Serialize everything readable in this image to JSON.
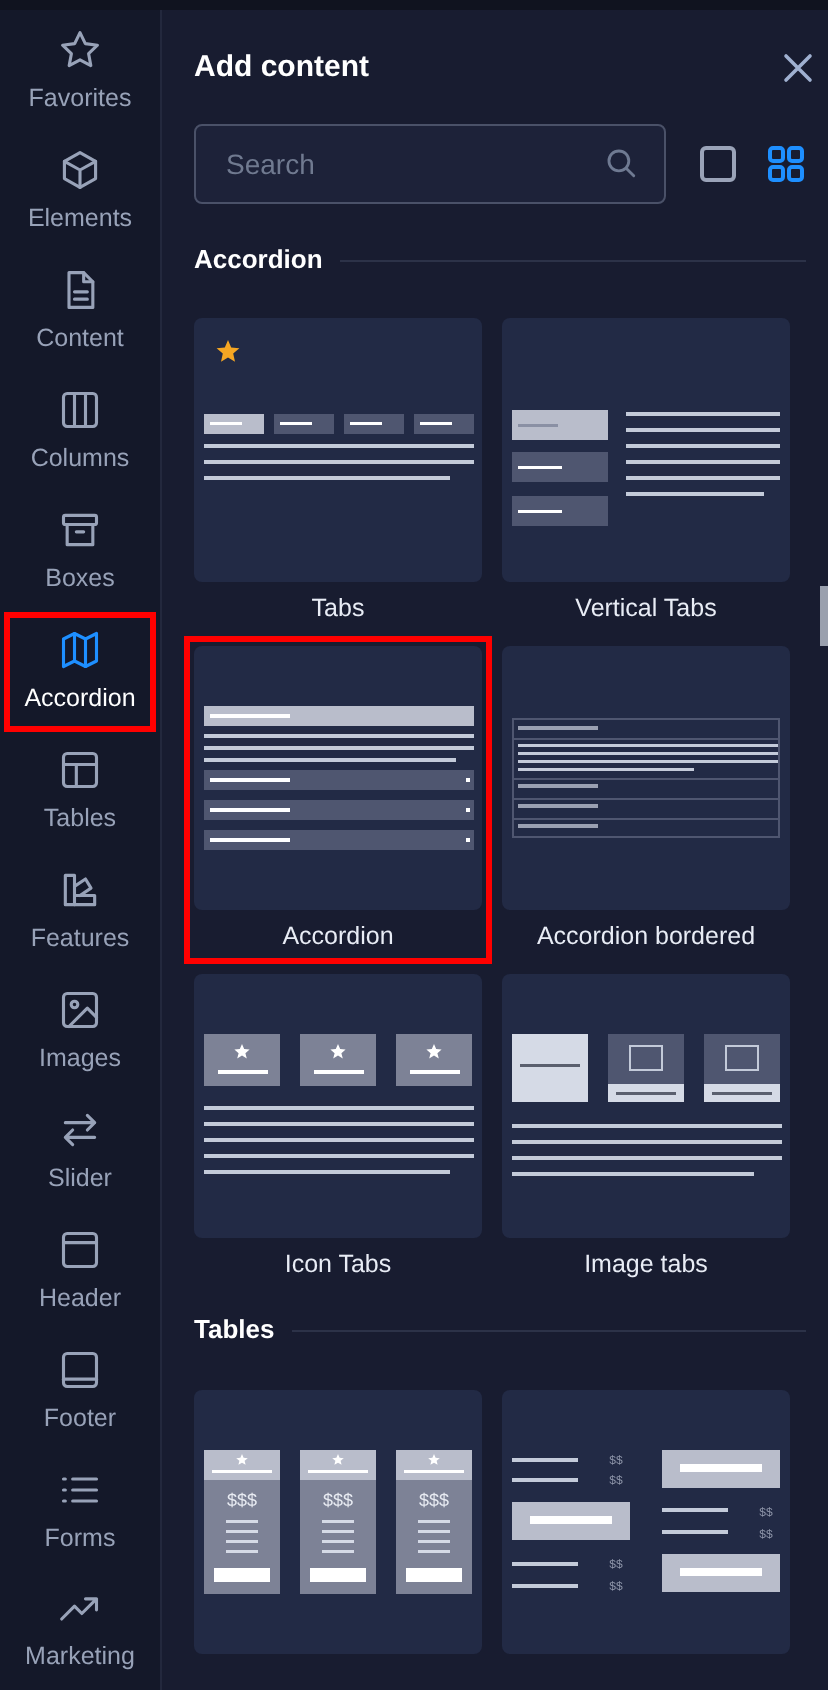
{
  "sidebar": {
    "items": [
      {
        "label": "Favorites",
        "selected": false,
        "highlighted": false
      },
      {
        "label": "Elements",
        "selected": false,
        "highlighted": false
      },
      {
        "label": "Content",
        "selected": false,
        "highlighted": false
      },
      {
        "label": "Columns",
        "selected": false,
        "highlighted": false
      },
      {
        "label": "Boxes",
        "selected": false,
        "highlighted": false
      },
      {
        "label": "Accordion",
        "selected": true,
        "highlighted": true
      },
      {
        "label": "Tables",
        "selected": false,
        "highlighted": false
      },
      {
        "label": "Features",
        "selected": false,
        "highlighted": false
      },
      {
        "label": "Images",
        "selected": false,
        "highlighted": false
      },
      {
        "label": "Slider",
        "selected": false,
        "highlighted": false
      },
      {
        "label": "Header",
        "selected": false,
        "highlighted": false
      },
      {
        "label": "Footer",
        "selected": false,
        "highlighted": false
      },
      {
        "label": "Forms",
        "selected": false,
        "highlighted": false
      },
      {
        "label": "Marketing",
        "selected": false,
        "highlighted": false
      }
    ]
  },
  "panel": {
    "title": "Add content",
    "search": {
      "placeholder": "Search"
    },
    "view_modes": [
      {
        "kind": "single",
        "selected": false
      },
      {
        "kind": "grid",
        "selected": true
      }
    ],
    "sections": [
      {
        "title": "Accordion",
        "cards": [
          {
            "label": "Tabs",
            "kind": "tabs",
            "favorite": true,
            "highlighted": false
          },
          {
            "label": "Vertical Tabs",
            "kind": "vertical_tabs",
            "favorite": false,
            "highlighted": false
          },
          {
            "label": "Accordion",
            "kind": "accordion",
            "favorite": false,
            "highlighted": true
          },
          {
            "label": "Accordion bordered",
            "kind": "accordion_bordered",
            "favorite": false,
            "highlighted": false
          },
          {
            "label": "Icon Tabs",
            "kind": "icon_tabs",
            "favorite": false,
            "highlighted": false
          },
          {
            "label": "Image tabs",
            "kind": "image_tabs",
            "favorite": false,
            "highlighted": false
          }
        ]
      },
      {
        "title": "Tables",
        "cards": [
          {
            "kind": "plans",
            "favorite": false,
            "highlighted": false,
            "price_labels": [
              "$$$",
              "$$$",
              "$$$"
            ]
          },
          {
            "kind": "price_list",
            "favorite": false,
            "highlighted": false,
            "price_labels": [
              "$$",
              "$$",
              "$$",
              "$$",
              "$$",
              "$$"
            ]
          }
        ]
      }
    ]
  }
}
